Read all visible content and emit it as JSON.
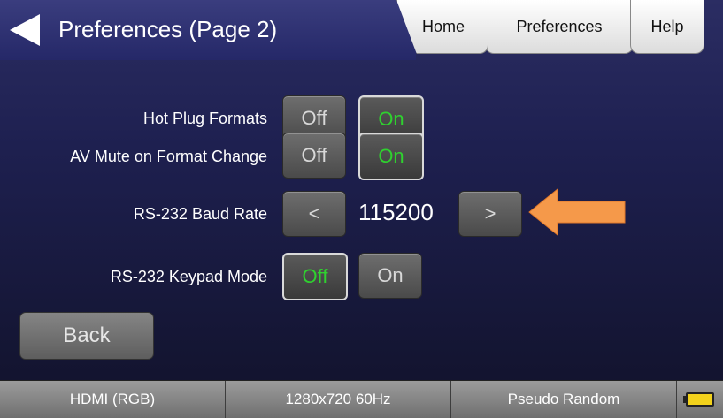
{
  "header": {
    "title": "Preferences (Page 2)",
    "tabs": [
      {
        "label": "Home"
      },
      {
        "label": "Preferences"
      },
      {
        "label": "Help"
      }
    ]
  },
  "settings": {
    "hot_plug": {
      "label": "Hot Plug Formats",
      "off": "Off",
      "on": "On",
      "selected": "On"
    },
    "av_mute": {
      "label": "AV Mute on Format Change",
      "off": "Off",
      "on": "On",
      "selected": "On"
    },
    "baud": {
      "label": "RS-232 Baud Rate",
      "prev": "<",
      "value": "115200",
      "next": ">"
    },
    "keypad": {
      "label": "RS-232 Keypad Mode",
      "off": "Off",
      "on": "On",
      "selected": "Off"
    }
  },
  "back_label": "Back",
  "status_bar": {
    "format": "HDMI (RGB)",
    "resolution": "1280x720 60Hz",
    "pattern": "Pseudo Random"
  },
  "colors": {
    "active_text": "#2fd12f",
    "annotation_arrow": "#f5994a",
    "battery": "#f2d21c"
  },
  "icons": {
    "back": "back-arrow-icon",
    "battery": "battery-icon",
    "annotation": "left-arrow-annotation-icon"
  }
}
